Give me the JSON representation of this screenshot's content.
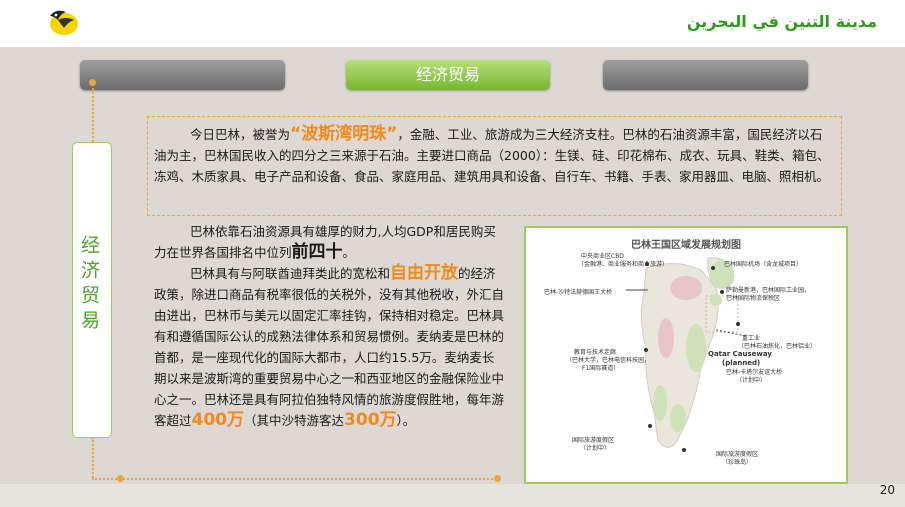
{
  "header": {
    "arabic_title": "مدينة التنين في البحرين",
    "logo_icon": "dragon-logo-icon"
  },
  "tabs": [
    {
      "label": ""
    },
    {
      "label": "经济贸易"
    },
    {
      "label": ""
    }
  ],
  "side_label": {
    "text": "经济贸易"
  },
  "paragraph1": {
    "pre": "今日巴林，被誉为",
    "highlight": "“波斯湾明珠”",
    "post": "，金融、工业、旅游成为三大经济支柱。巴林的石油资源丰富，国民经济以石油为主，巴林国民收入的四分之三来源于石油。主要进口商品（2000）：生镁、硅、印花棉布、成衣、玩具、鞋类、箱包、冻鸡、木质家具、电子产品和设备、食品、家庭用品、建筑用具和设备、自行车、书籍、手表、家用器皿、电脑、照相机。"
  },
  "paragraph2": {
    "a1": "巴林依靠石油资源具有雄厚的财力,人均GDP和居民购买力在世界各国排名中位列",
    "a_highlight": "前四十",
    "a2": "。",
    "b1": "巴林具有与阿联酋迪拜类此的宽松和",
    "b_highlight": "自由开放",
    "b2": "的经济政策，除进口商品有税率很低的关税外，没有其他税收，外汇自由进出，巴林币与美元以固定汇率挂钩，保持相对稳定。巴林具有和遵循国际公认的成熟法律体系和贸易惯例。麦纳麦是巴林的首都，是一座现代化的国际大都市，人口约15.5万。麦纳麦长期以来是波斯湾的重要贸易中心之一和西亚地区的金融保险业中心之一。巴林还是具有阿拉伯独特风情的旅游度假胜地，每年游客超过",
    "c_highlight": "400万",
    "c2": "（其中沙特游客达",
    "d_highlight": "300万",
    "d2": "）。"
  },
  "map": {
    "title": "巴林王国区域发展规划图",
    "labels": [
      "中央商业区CBD",
      "（金融港、商业服务和商业旅游）",
      "巴林国际机场（含龙城项目）",
      "巴林-沙特法赫德国王大桥",
      "萨勒曼新港，巴林国际工业园，",
      "巴林国际物流保税区",
      "重工业",
      "（巴林石油炼化，巴林铝业）",
      "教育与技术走廊",
      "（巴林大学，巴林电信科技园，",
      "F1国际赛道）",
      "Qatar Causeway",
      "(planned)",
      "巴林-卡塔尔友谊大桥",
      "（计划中）",
      "国际旅游度假区",
      "（计划中）",
      "国际旅游度假区",
      "（珍珠岛）"
    ]
  },
  "page_number": "20"
}
